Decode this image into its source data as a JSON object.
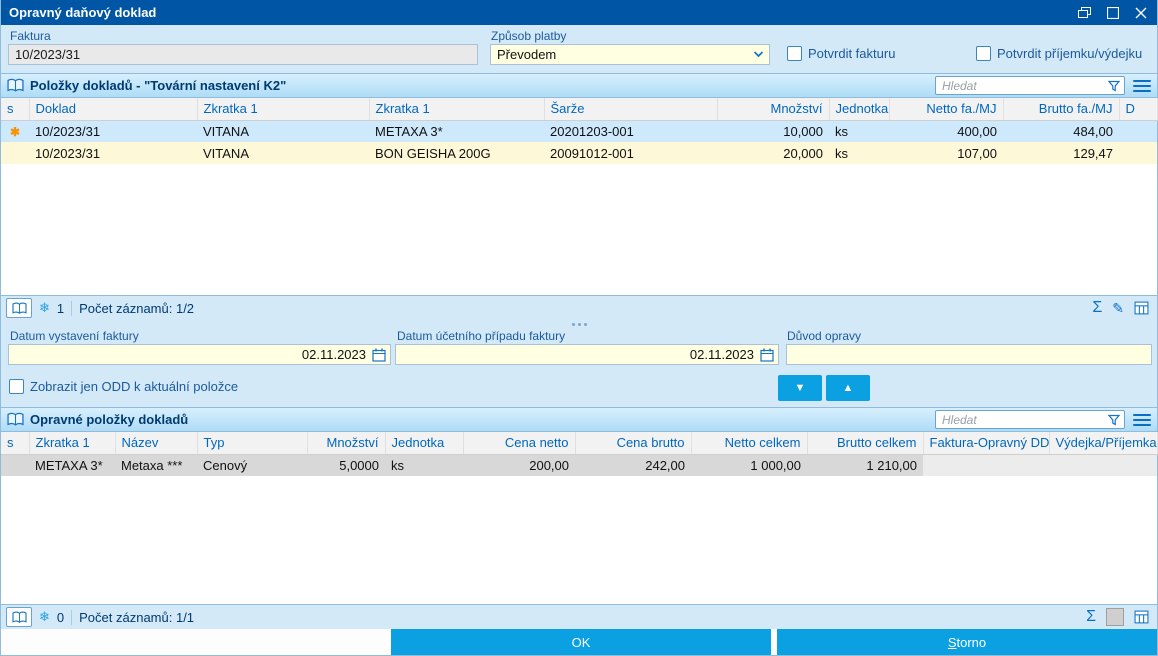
{
  "window": {
    "title": "Opravný daňový doklad"
  },
  "icons": {
    "record_flag": "✱",
    "snowflake": "❄",
    "sigma": "Σ",
    "pencil": "✎",
    "arrow_down": "▼",
    "arrow_up": "▲"
  },
  "top_form": {
    "faktura": {
      "label": "Faktura",
      "value": "10/2023/31"
    },
    "zpusob_platby": {
      "label": "Způsob platby",
      "value": "Převodem"
    },
    "potvrdit_fakturu_label": "Potvrdit fakturu",
    "potvrdit_prijemku_label": "Potvrdit příjemku/výdejku"
  },
  "items_section": {
    "title": "Položky dokladů - \"Tovární nastavení K2\"",
    "search_placeholder": "Hledat",
    "columns": [
      "s",
      "Doklad",
      "Zkratka 1",
      "Zkratka 1",
      "Šarže",
      "Množství",
      "Jednotka",
      "Netto fa./MJ",
      "Brutto fa./MJ",
      "D"
    ],
    "rows": [
      {
        "doklad": "10/2023/31",
        "zkratka1": "VITANA",
        "zkratka2": "METAXA 3*",
        "sarze": "20201203-001",
        "mnozstvi": "10,000",
        "jednotka": "ks",
        "netto": "400,00",
        "brutto": "484,00",
        "d": ""
      },
      {
        "doklad": "10/2023/31",
        "zkratka1": "VITANA",
        "zkratka2": "BON GEISHA 200G",
        "sarze": "20091012-001",
        "mnozstvi": "20,000",
        "jednotka": "ks",
        "netto": "107,00",
        "brutto": "129,47",
        "d": ""
      }
    ],
    "status": {
      "lock_count": "1",
      "records": "Počet záznamů: 1/2"
    }
  },
  "mid_form": {
    "datum_vystaveni": {
      "label": "Datum vystavení faktury",
      "value": "02.11.2023"
    },
    "datum_ucetniho": {
      "label": "Datum účetního případu faktury",
      "value": "02.11.2023"
    },
    "duvod_opravy": {
      "label": "Důvod opravy",
      "value": ""
    },
    "zobrazit_odd_label": "Zobrazit jen ODD k aktuální položce"
  },
  "corrections_section": {
    "title": "Opravné položky dokladů",
    "search_placeholder": "Hledat",
    "columns": [
      "s",
      "Zkratka 1",
      "Název",
      "Typ",
      "Množství",
      "Jednotka",
      "Cena netto",
      "Cena brutto",
      "Netto celkem",
      "Brutto celkem",
      "Faktura-Opravný DD",
      "Výdejka/Příjemka"
    ],
    "rows": [
      {
        "zkratka1": "METAXA 3*",
        "nazev": "Metaxa ***",
        "typ": "Cenový",
        "mnozstvi": "5,0000",
        "jednotka": "ks",
        "cena_netto": "200,00",
        "cena_brutto": "242,00",
        "netto_celkem": "1 000,00",
        "brutto_celkem": "1 210,00",
        "faktura_odd": "",
        "vydejka": ""
      }
    ],
    "status": {
      "lock_count": "0",
      "records": "Počet záznamů: 1/1"
    }
  },
  "footer": {
    "ok_label": "OK",
    "storno_label": "Storno"
  },
  "colors": {
    "accent": "#0055a4",
    "button": "#0ba0e2",
    "row_selected": "#cfe9fc",
    "row_alt": "#fdf8d8",
    "input_yellow": "#ffffe1"
  }
}
